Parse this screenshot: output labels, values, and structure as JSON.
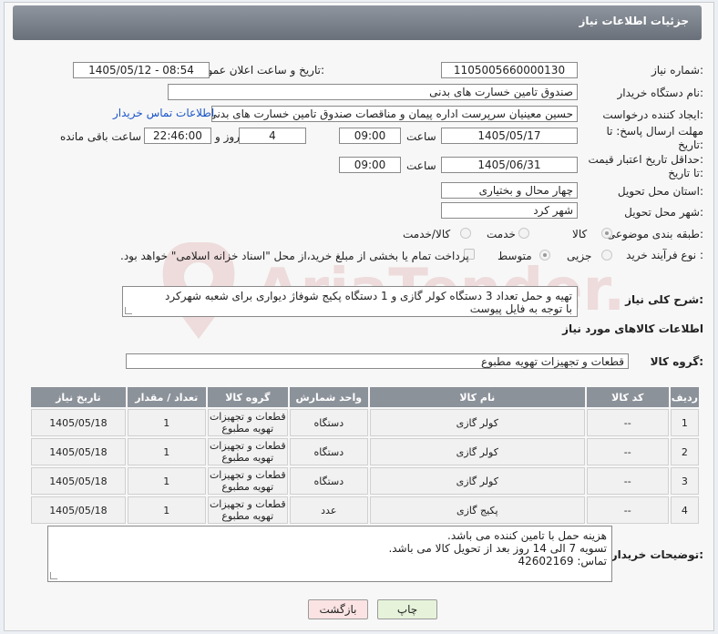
{
  "header": {
    "title": "جزئیات اطلاعات نیاز"
  },
  "fields": {
    "need_number_label": "شماره نیاز:",
    "need_number": "1105005660000130",
    "announce_label": "تاریخ و ساعت اعلان عمومی:",
    "announce_value": "1405/05/12 - 08:54",
    "buyer_org_label": "نام دستگاه خریدار:",
    "buyer_org": "صندوق تامین خسارت های بدنی",
    "creator_label": "ایجاد کننده درخواست:",
    "creator": "حسین  معینیان سرپرست اداره پیمان و مناقصات صندوق تامین خسارت های بدنی",
    "contact_link": "اطلاعات تماس خریدار",
    "deadline_label_1": "مهلت ارسال پاسخ: تا",
    "deadline_label_2": "تاریخ:",
    "deadline_date": "1405/05/17",
    "time_label": "ساعت",
    "deadline_time": "09:00",
    "days_value": "4",
    "days_label": "روز و",
    "remaining_time": "22:46:00",
    "remaining_label": "ساعت باقی مانده",
    "min_price_label_1": "حداقل تاریخ اعتبار قیمت:",
    "min_price_label_2": "تا تاریخ:",
    "validity_date": "1405/06/31",
    "validity_time": "09:00",
    "province_label": "استان محل تحویل:",
    "province": "چهار محال و بختیاری",
    "city_label": "شهر محل تحویل:",
    "city": "شهر کرد",
    "category_label": "طبقه بندی موضوعی:",
    "category_options": [
      "کالا",
      "خدمت",
      "کالا/خدمت"
    ],
    "process_label": "نوع فرآیند خرید :",
    "process_options": [
      "جزیی",
      "متوسط"
    ],
    "payment_note": "پرداخت تمام یا بخشی از مبلغ خرید،از محل \"اسناد خزانه اسلامی\" خواهد بود.",
    "summary_label": "شرح کلی نیاز:",
    "summary_line1": "تهیه و حمل تعداد 3 دستگاه کولر گازی و 1 دستگاه پکیج شوفاژ دیواری برای شعبه شهرکرد",
    "summary_line2": "با توجه به فایل پیوست",
    "goods_info_title": "اطلاعات کالاهای مورد نیاز",
    "goods_group_label": "گروه کالا:",
    "goods_group": "قطعات و تجهیزات تهویه مطبوع",
    "buyer_notes_label": "توضیحات خریدار:",
    "buyer_notes": [
      "هزینه حمل با تامین کننده می باشد.",
      "تسویه 7 الی 14 روز بعد از تحویل کالا می باشد.",
      "تماس: 42602169"
    ]
  },
  "table": {
    "headers": [
      "ردیف",
      "کد کالا",
      "نام کالا",
      "واحد شمارش",
      "گروه کالا",
      "تعداد / مقدار",
      "تاریخ نیاز"
    ],
    "rows": [
      [
        "1",
        "--",
        "کولر گازی",
        "دستگاه",
        "قطعات و تجهیزات تهویه مطبوع",
        "1",
        "1405/05/18"
      ],
      [
        "2",
        "--",
        "کولر گازی",
        "دستگاه",
        "قطعات و تجهیزات تهویه مطبوع",
        "1",
        "1405/05/18"
      ],
      [
        "3",
        "--",
        "کولر گازی",
        "دستگاه",
        "قطعات و تجهیزات تهویه مطبوع",
        "1",
        "1405/05/18"
      ],
      [
        "4",
        "--",
        "پکیج گازی",
        "عدد",
        "قطعات و تجهیزات تهویه مطبوع",
        "1",
        "1405/05/18"
      ]
    ]
  },
  "buttons": {
    "print": "چاپ",
    "back": "بازگشت"
  },
  "watermark": {
    "text": "AriaTender.net"
  }
}
